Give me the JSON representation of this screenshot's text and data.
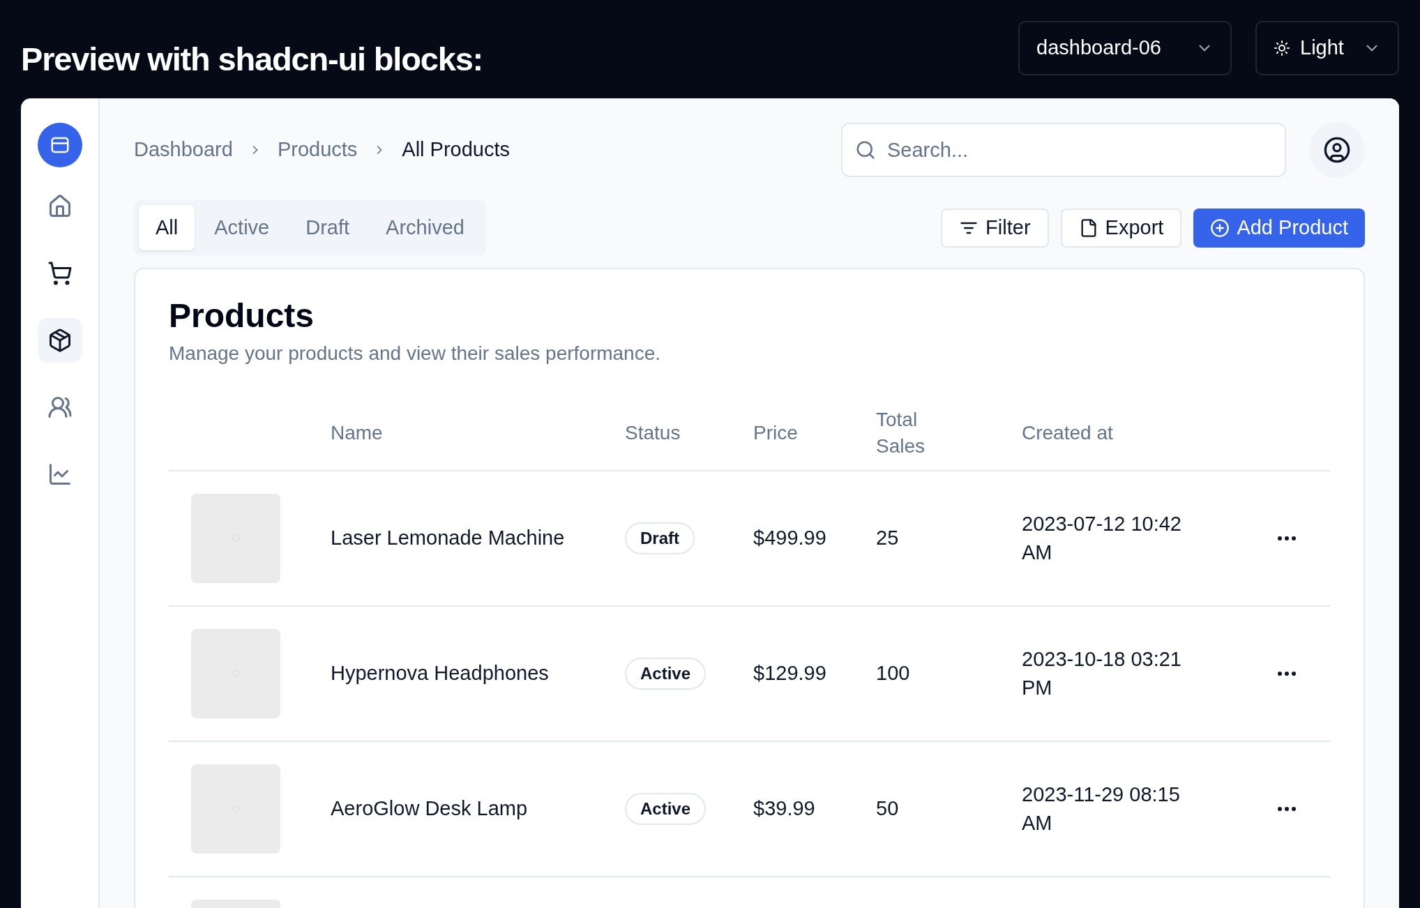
{
  "header": {
    "title": "Preview with shadcn-ui blocks:",
    "block_select": "dashboard-06",
    "theme_select": "Light"
  },
  "sidebar": {
    "items": [
      {
        "kind": "home",
        "selected": false
      },
      {
        "kind": "cart",
        "selected": false
      },
      {
        "kind": "package",
        "selected": true
      },
      {
        "kind": "users",
        "selected": false
      },
      {
        "kind": "chart",
        "selected": false
      }
    ]
  },
  "breadcrumb": [
    "Dashboard",
    "Products",
    "All Products"
  ],
  "search": {
    "placeholder": "Search..."
  },
  "tabs": [
    {
      "label": "All",
      "selected": true
    },
    {
      "label": "Active",
      "selected": false
    },
    {
      "label": "Draft",
      "selected": false
    },
    {
      "label": "Archived",
      "selected": false
    }
  ],
  "actions": [
    {
      "kind": "filter",
      "label": "Filter"
    },
    {
      "kind": "export",
      "label": "Export"
    },
    {
      "kind": "add",
      "label": "Add Product"
    }
  ],
  "card": {
    "title": "Products",
    "description": "Manage your products and view their sales performance."
  },
  "table": {
    "columns": [
      "Name",
      "Status",
      "Price",
      "Total Sales",
      "Created at"
    ],
    "rows": [
      {
        "kind": "full",
        "name": "Laser Lemonade Machine",
        "status": "Draft",
        "price": "$499.99",
        "total_sales": "25",
        "created_at": "2023-07-12 10:42 AM"
      },
      {
        "kind": "full",
        "name": "Hypernova Headphones",
        "status": "Active",
        "price": "$129.99",
        "total_sales": "100",
        "created_at": "2023-10-18 03:21 PM"
      },
      {
        "kind": "full",
        "name": "AeroGlow Desk Lamp",
        "status": "Active",
        "price": "$39.99",
        "total_sales": "50",
        "created_at": "2023-11-29 08:15 AM"
      },
      {
        "kind": "cut_off"
      }
    ]
  }
}
